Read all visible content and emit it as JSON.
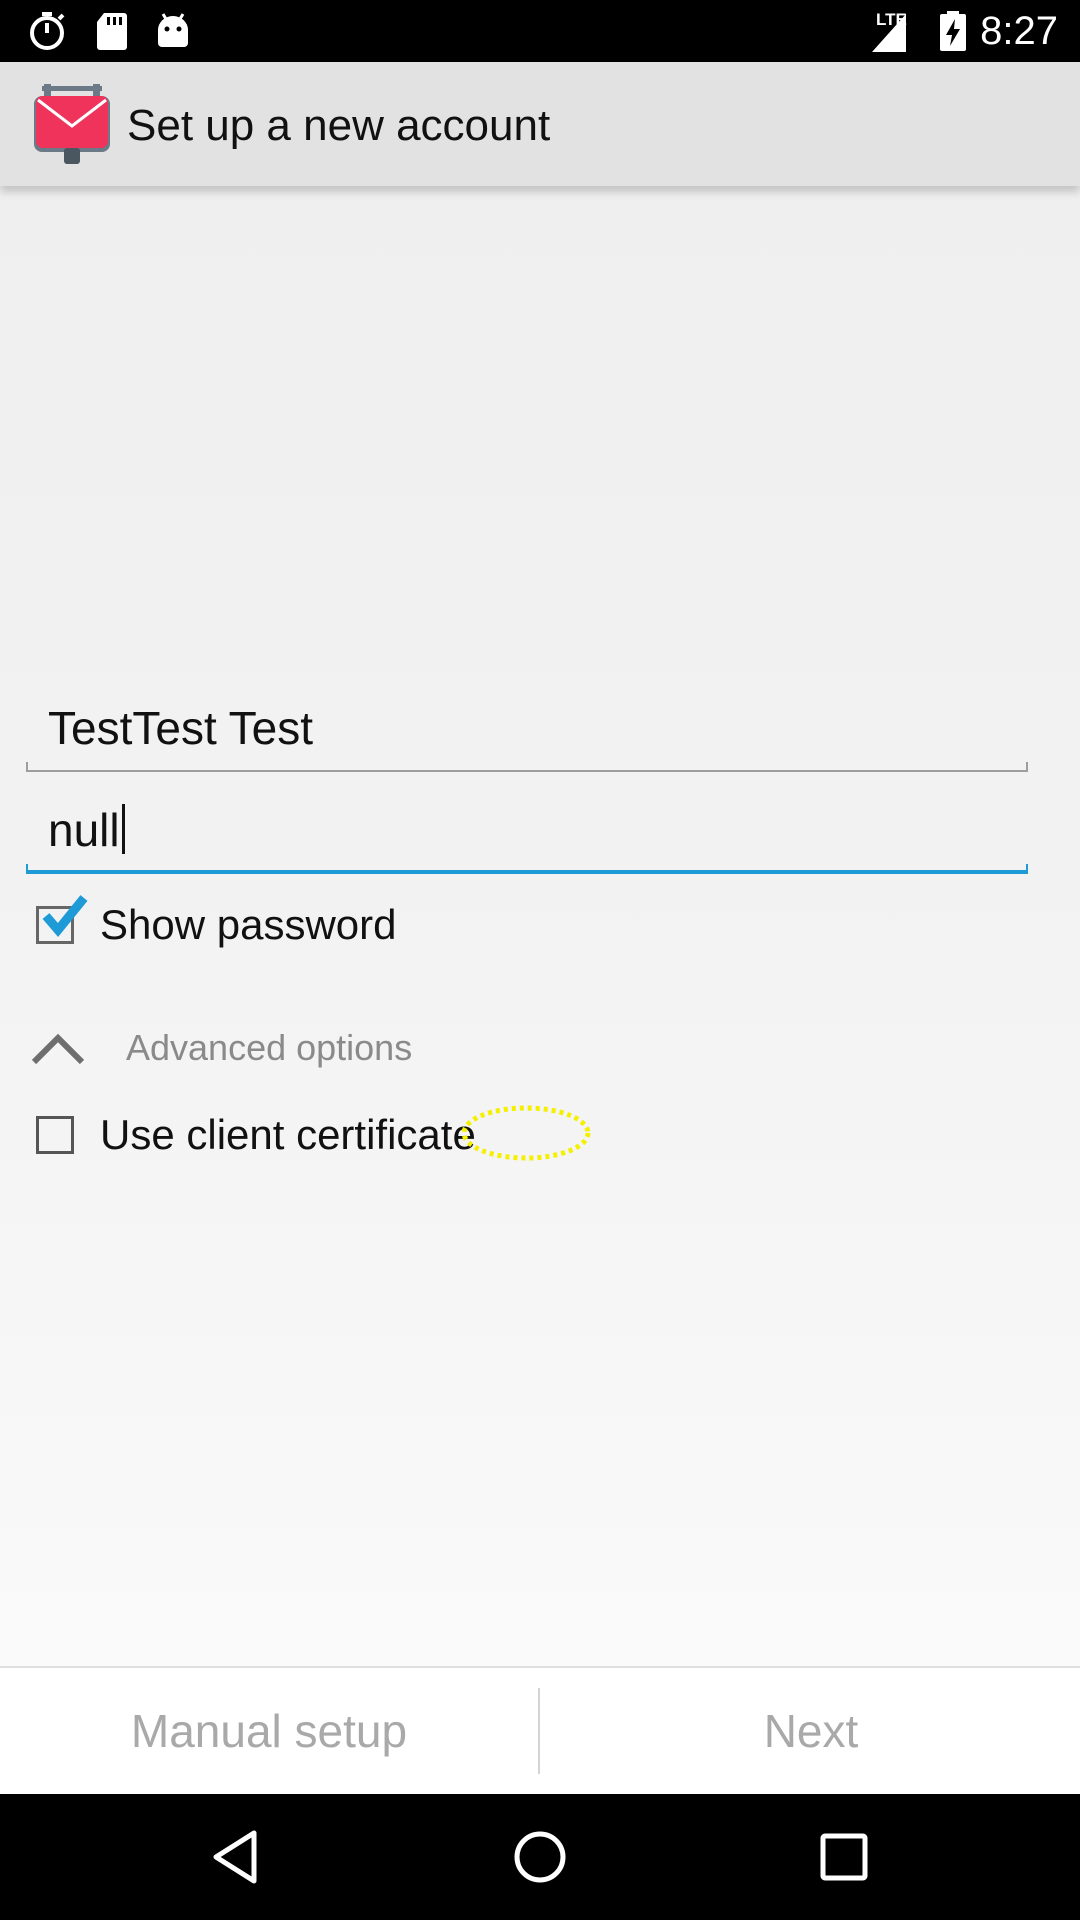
{
  "status_bar": {
    "time": "8:27",
    "network": "LTE",
    "icons": [
      "stopwatch-icon",
      "sd-card-icon",
      "android-icon",
      "lte-signal-icon",
      "battery-charging-icon"
    ]
  },
  "app_bar": {
    "title": "Set up a new account",
    "logo": "k9-mail-logo-icon",
    "logo_color": "#f0335a"
  },
  "form": {
    "name_value": "TestTest Test",
    "password_value": "null",
    "show_password_label": "Show password",
    "show_password_checked": true,
    "advanced_label": "Advanced options",
    "advanced_expanded": true,
    "client_cert_label": "Use client certificate",
    "client_cert_checked": false,
    "accent_color": "#1e9bd7"
  },
  "buttons": {
    "manual_setup_label": "Manual setup",
    "next_label": "Next"
  },
  "nav_bar": {
    "icons": [
      "back-icon",
      "home-icon",
      "recents-icon"
    ]
  }
}
